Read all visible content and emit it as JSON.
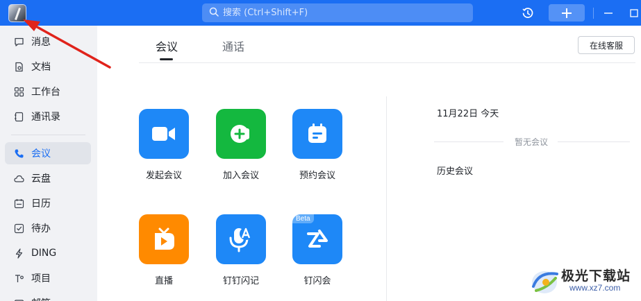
{
  "titlebar": {
    "search_placeholder": "搜索 (Ctrl+Shift+F)",
    "accent_color": "#1b6ef3",
    "icons": [
      "avatar",
      "search-icon",
      "history-icon",
      "plus-icon",
      "minimize-icon",
      "maximize-icon"
    ]
  },
  "sidebar": {
    "items": [
      {
        "label": "消息",
        "icon": "message-icon"
      },
      {
        "label": "文档",
        "icon": "document-icon"
      },
      {
        "label": "工作台",
        "icon": "workbench-icon"
      },
      {
        "label": "通讯录",
        "icon": "contacts-icon"
      },
      {
        "label": "会议",
        "icon": "phone-icon",
        "active": true
      },
      {
        "label": "云盘",
        "icon": "cloud-icon"
      },
      {
        "label": "日历",
        "icon": "calendar-icon"
      },
      {
        "label": "待办",
        "icon": "todo-icon"
      },
      {
        "label": "DING",
        "icon": "ding-icon"
      },
      {
        "label": "项目",
        "icon": "project-icon"
      },
      {
        "label": "邮箱",
        "icon": "mail-icon"
      }
    ]
  },
  "main": {
    "tabs": [
      {
        "label": "会议",
        "active": true
      },
      {
        "label": "通话",
        "active": false
      }
    ],
    "service_button": "在线客服",
    "tiles": [
      {
        "label": "发起会议",
        "icon": "video-camera-icon",
        "color": "#1e88f7"
      },
      {
        "label": "加入会议",
        "icon": "join-meeting-icon",
        "color": "#14b83f"
      },
      {
        "label": "预约会议",
        "icon": "schedule-icon",
        "color": "#1e88f7"
      },
      {
        "label": "直播",
        "icon": "live-tv-icon",
        "color": "#ff8a00"
      },
      {
        "label": "钉钉闪记",
        "icon": "voice-note-icon",
        "color": "#1e88f7"
      },
      {
        "label": "钉闪会",
        "icon": "flash-meeting-icon",
        "color": "#1e88f7",
        "badge": "Beta"
      }
    ],
    "right_panel": {
      "date": "11月22日 今天",
      "empty_text": "暂无会议",
      "history": "历史会议"
    }
  },
  "watermark": {
    "title": "极光下载站",
    "url": "www.xz7.com"
  }
}
